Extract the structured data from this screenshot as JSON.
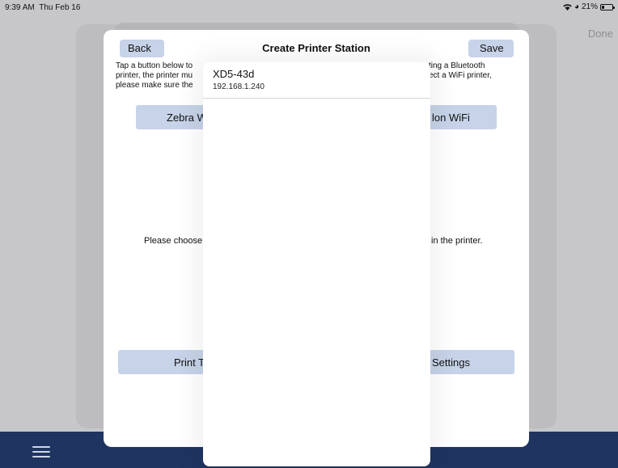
{
  "status_bar": {
    "time": "9:39 AM",
    "date": "Thu Feb 16",
    "battery_text": "21%"
  },
  "background": {
    "done_label": "Done"
  },
  "modal": {
    "title": "Create Printer Station",
    "back_label": "Back",
    "save_label": "Save",
    "intro_left_lines": [
      "Tap a button below to",
      "printer, the printer mu",
      "please make sure the"
    ],
    "intro_right_lines": [
      "ting a Bluetooth",
      "ect a WiFi printer,"
    ],
    "zebra_button_label": "Zebra W",
    "wifi_button_label": "lon WiFi",
    "choose_left": "Please choose",
    "choose_right": "in the printer.",
    "print_button_label": "Print T",
    "settings_button_label": "Settings"
  },
  "popover": {
    "printers": [
      {
        "name": "XD5-43d",
        "ip": "192.168.1.240"
      }
    ]
  },
  "colors": {
    "button_bg": "#c6d3e8",
    "bottom_bar": "#1f3461"
  }
}
